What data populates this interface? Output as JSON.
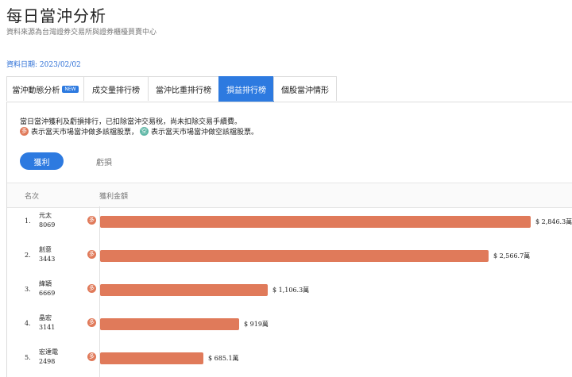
{
  "page": {
    "title": "每日當沖分析",
    "subtitle": "資料來源為台灣證券交易所與證券櫃檯買賣中心",
    "date": "資料日期: 2023/02/02"
  },
  "tabs": [
    {
      "label": "當沖動態分析",
      "badge": "NEW",
      "active": false
    },
    {
      "label": "成交量排行榜",
      "active": false
    },
    {
      "label": "當沖比重排行榜",
      "active": false
    },
    {
      "label": "損益排行榜",
      "active": true
    },
    {
      "label": "個股當沖情形",
      "active": false
    }
  ],
  "notes": {
    "line1": "當日當沖獲利及虧損排行，已扣除當沖交易稅，尚未扣除交易手續費。",
    "line2": "表示當天市場當沖做多該檔股票，",
    "line3": "表示當天市場當沖做空該檔股票。",
    "long_glyph": "多",
    "short_glyph": "空"
  },
  "toggle": {
    "profit": "獲利",
    "loss": "虧損",
    "selected": "profit"
  },
  "table": {
    "col_rank": "名次",
    "col_amount": "獲利金額",
    "max_value": 2846.3,
    "rows": [
      {
        "rank": "1.",
        "name": "元太",
        "code": "8069",
        "dir": "多",
        "value": 2846.3,
        "label": "$ 2,846.3萬"
      },
      {
        "rank": "2.",
        "name": "創意",
        "code": "3443",
        "dir": "多",
        "value": 2566.7,
        "label": "$ 2,566.7萬"
      },
      {
        "rank": "3.",
        "name": "緯穎",
        "code": "6669",
        "dir": "多",
        "value": 1106.3,
        "label": "$ 1,106.3萬"
      },
      {
        "rank": "4.",
        "name": "晶宏",
        "code": "3141",
        "dir": "多",
        "value": 919,
        "label": "$ 919萬"
      },
      {
        "rank": "5.",
        "name": "宏達電",
        "code": "2498",
        "dir": "多",
        "value": 685.1,
        "label": "$ 685.1萬"
      }
    ]
  },
  "colors": {
    "accent": "#2d7ae0",
    "bar": "#e07a5a",
    "short": "#5fb7a6"
  }
}
